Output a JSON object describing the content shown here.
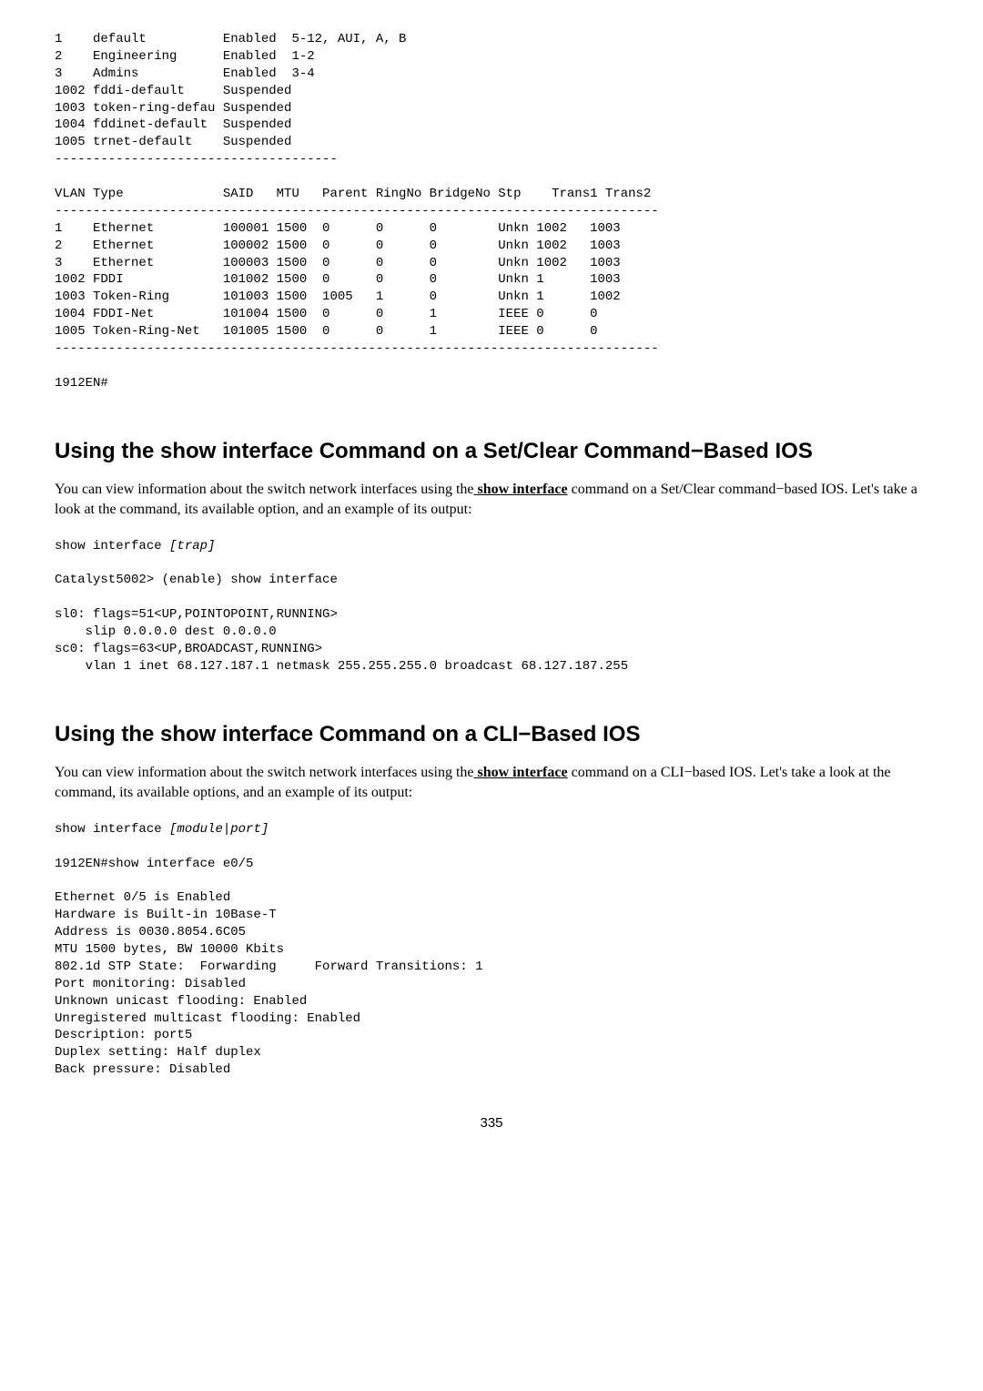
{
  "pre1": "1    default          Enabled  5-12, AUI, A, B\n2    Engineering      Enabled  1-2\n3    Admins           Enabled  3-4\n1002 fddi-default     Suspended\n1003 token-ring-defau Suspended\n1004 fddinet-default  Suspended\n1005 trnet-default    Suspended\n-------------------------------------\n\nVLAN Type             SAID   MTU   Parent RingNo BridgeNo Stp    Trans1 Trans2\n-------------------------------------------------------------------------------\n1    Ethernet         100001 1500  0      0      0        Unkn 1002   1003\n2    Ethernet         100002 1500  0      0      0        Unkn 1002   1003\n3    Ethernet         100003 1500  0      0      0        Unkn 1002   1003\n1002 FDDI             101002 1500  0      0      0        Unkn 1      1003\n1003 Token-Ring       101003 1500  1005   1      0        Unkn 1      1002\n1004 FDDI-Net         101004 1500  0      0      1        IEEE 0      0\n1005 Token-Ring-Net   101005 1500  0      0      1        IEEE 0      0\n-------------------------------------------------------------------------------\n\n1912EN#",
  "h2a": "Using the show interface Command on a Set/Clear Command−Based IOS",
  "p1a": "You can view information about the switch network interfaces using the",
  "p1cmd": " show interface",
  "p1b": " command on a Set/Clear command−based IOS. Let's take a look at the command, its available option, and an example of its output:",
  "pre2a": "show interface ",
  "pre2i": "[trap]",
  "pre2b": "\n\nCatalyst5002> (enable) show interface\n\nsl0: flags=51<UP,POINTOPOINT,RUNNING>\n    slip 0.0.0.0 dest 0.0.0.0\nsc0: flags=63<UP,BROADCAST,RUNNING>\n    vlan 1 inet 68.127.187.1 netmask 255.255.255.0 broadcast 68.127.187.255",
  "h2b": "Using the show interface Command on a CLI−Based IOS",
  "p2a": "You can view information about the switch network interfaces using the",
  "p2cmd": " show interface",
  "p2b": " command on a CLI−based IOS. Let's take a look at the command, its available options, and an example of its output:",
  "pre3a": "show interface ",
  "pre3i": "[module|port]",
  "pre3b": "\n\n1912EN#show interface e0/5\n\nEthernet 0/5 is Enabled\nHardware is Built-in 10Base-T\nAddress is 0030.8054.6C05\nMTU 1500 bytes, BW 10000 Kbits\n802.1d STP State:  Forwarding     Forward Transitions: 1\nPort monitoring: Disabled\nUnknown unicast flooding: Enabled\nUnregistered multicast flooding: Enabled\nDescription: port5\nDuplex setting: Half duplex\nBack pressure: Disabled",
  "pagenum": "335"
}
